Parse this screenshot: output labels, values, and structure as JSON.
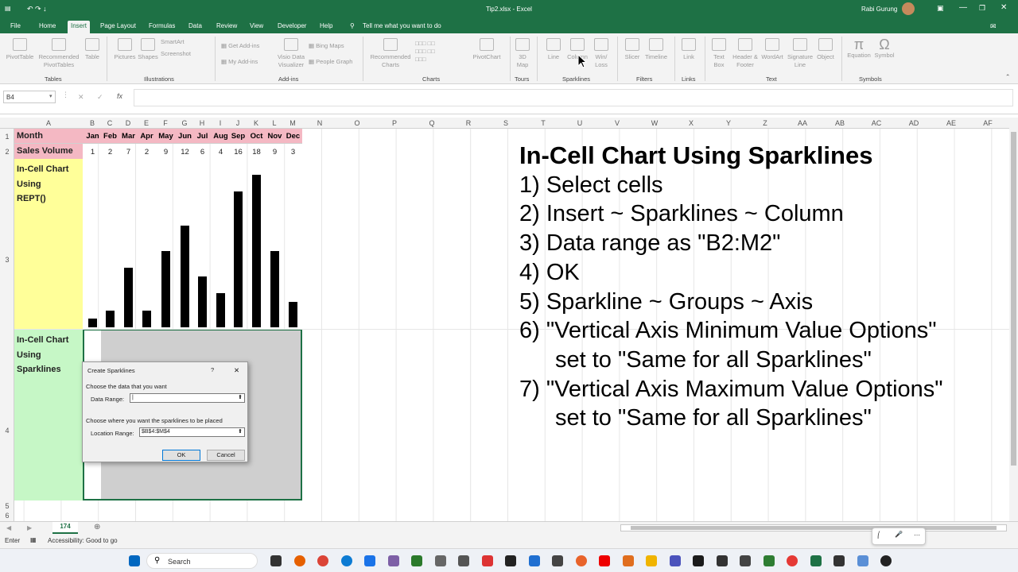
{
  "window": {
    "quick_access": "↶  ↷  ↓",
    "title": "Tip2.xlsx - Excel",
    "user": "Rabi Gurung"
  },
  "tabs": [
    "File",
    "Home",
    "Insert",
    "Page Layout",
    "Formulas",
    "Data",
    "Review",
    "View",
    "Developer",
    "Help"
  ],
  "tell_me": "Tell me what you want to do",
  "ribbon": {
    "tables": {
      "items": [
        "PivotTable",
        "Recommended PivotTables",
        "Table"
      ],
      "group": "Tables"
    },
    "illustrations": {
      "items": [
        "Pictures",
        "Shapes",
        "SmartArt",
        "Screenshot"
      ],
      "group": "Illustrations"
    },
    "addins": {
      "items": [
        "Get Add-ins",
        "My Add-ins",
        "Visio Data Visualizer",
        "Bing Maps",
        "People Graph"
      ],
      "group": "Add-ins"
    },
    "charts": {
      "items": [
        "Recommended Charts",
        "PivotChart"
      ],
      "group": "Charts"
    },
    "tours": {
      "items": [
        "3D Map"
      ],
      "group": "Tours"
    },
    "sparklines": {
      "items": [
        "Line",
        "Column",
        "Win/ Loss"
      ],
      "group": "Sparklines"
    },
    "filters": {
      "items": [
        "Slicer",
        "Timeline"
      ],
      "group": "Filters"
    },
    "links": {
      "items": [
        "Link"
      ],
      "group": "Links"
    },
    "text": {
      "items": [
        "Text Box",
        "Header & Footer",
        "WordArt",
        "Signature Line",
        "Object"
      ],
      "group": "Text"
    },
    "symbols": {
      "items": [
        "Equation",
        "Symbol"
      ],
      "group": "Symbols"
    }
  },
  "formula_bar": {
    "name_box": "B4",
    "fx": "fx",
    "value": ""
  },
  "columns": [
    "A",
    "B",
    "C",
    "D",
    "E",
    "F",
    "G",
    "H",
    "I",
    "J",
    "K",
    "L",
    "M",
    "N",
    "O",
    "P",
    "Q",
    "R",
    "S",
    "T",
    "U",
    "V",
    "W",
    "X",
    "Y",
    "Z",
    "AA",
    "AB",
    "AC",
    "AD",
    "AE",
    "AF"
  ],
  "rows": [
    "1",
    "2",
    "3",
    "4",
    "5",
    "6"
  ],
  "sheet": {
    "a1": "Month",
    "a2": "Sales Volume",
    "a3_lines": [
      "In-Cell Chart",
      "Using",
      "REPT()"
    ],
    "a4_lines": [
      "In-Cell Chart",
      "Using",
      "Sparklines"
    ],
    "months": [
      "Jan",
      "Feb",
      "Mar",
      "Apr",
      "May",
      "Jun",
      "Jul",
      "Aug",
      "Sep",
      "Oct",
      "Nov",
      "Dec"
    ],
    "sales": [
      1,
      2,
      7,
      2,
      9,
      12,
      6,
      4,
      16,
      18,
      9,
      3
    ]
  },
  "instructions": {
    "title": "In-Cell Chart Using Sparklines",
    "steps": [
      "1) Select cells",
      "2) Insert ~ Sparklines ~ Column",
      "3) Data range as \"B2:M2\"",
      "4) OK",
      "5) Sparkline ~ Groups ~ Axis",
      "6) \"Vertical Axis Minimum Value Options\"",
      "set to \"Same for all Sparklines\"",
      "7) \"Vertical Axis Maximum Value Options\"",
      "set to \"Same for all Sparklines\""
    ]
  },
  "dialog": {
    "title": "Create Sparklines",
    "help": "?",
    "close": "✕",
    "section1": "Choose the data that you want",
    "data_range_label": "Data Range:",
    "data_range_value": "|",
    "section2": "Choose where you want the sparklines to be placed",
    "location_label": "Location Range:",
    "location_value": "$B$4:$M$4",
    "ok": "OK",
    "cancel": "Cancel"
  },
  "sheet_tab": "174",
  "add_sheet": "⊕",
  "status": {
    "mode": "Enter",
    "accessibility": "Accessibility: Good to go"
  },
  "taskbar": {
    "search": "Search"
  },
  "colors": {
    "excel_green": "#1e7145",
    "pink": "#f4b8c3",
    "yellow": "#ffff99",
    "green": "#c6f7c6"
  }
}
